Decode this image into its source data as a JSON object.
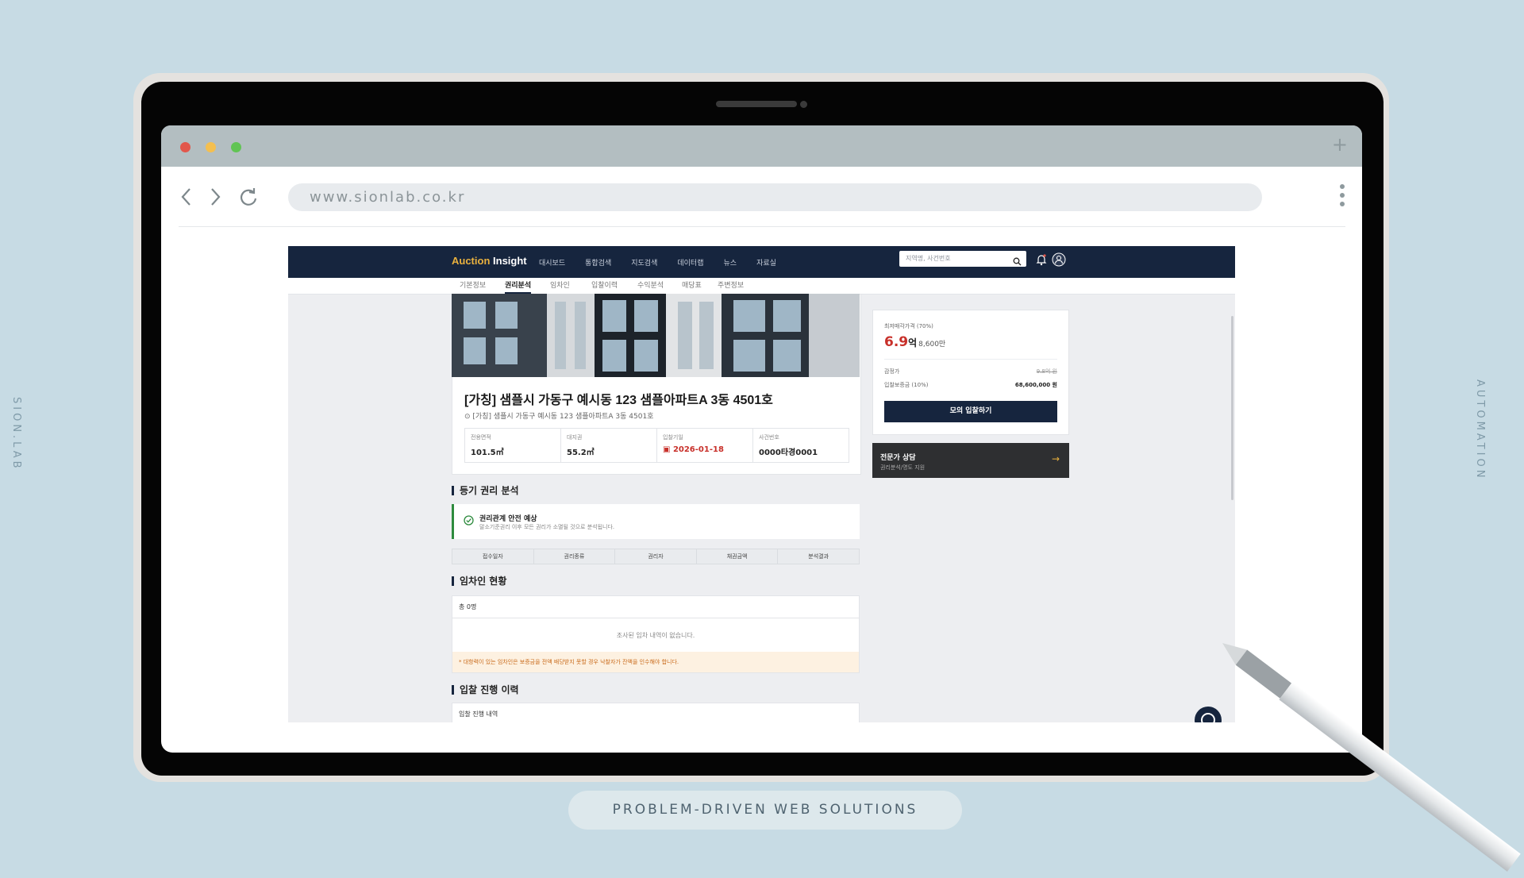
{
  "side": {
    "left": "SION.LAB",
    "right": "AUTOMATION"
  },
  "caption": "PROBLEM-DRIVEN WEB SOLUTIONS",
  "browser": {
    "url": "www.sionlab.co.kr",
    "new_tab_symbol": "+"
  },
  "site": {
    "logo_a": "Auction",
    "logo_b": "Insight",
    "menu": [
      "대시보드",
      "통합검색",
      "지도검색",
      "데이터랩",
      "뉴스",
      "자료실"
    ],
    "search_placeholder": "지역명, 사건번호"
  },
  "tabs": [
    "기본정보",
    "권리분석",
    "임차인",
    "입찰이력",
    "수익분석",
    "매당표",
    "주변정보"
  ],
  "active_tab": "권리분석",
  "property": {
    "title": "[가칭] 샘플시 가동구 예시동 123 샘플아파트A 3동 4501호",
    "address": "[가칭] 샘플시 가동구 예시동 123 샘플아파트A 3동 4501호",
    "info": [
      {
        "label": "전용면적",
        "value": "101.5㎡"
      },
      {
        "label": "대지권",
        "value": "55.2㎡"
      },
      {
        "label": "입찰기일",
        "value": "2026-01-18"
      },
      {
        "label": "사건번호",
        "value": "0000타경0001"
      }
    ]
  },
  "rights": {
    "section_title": "등기 권리 분석",
    "notice_title": "권리관계 안전 예상",
    "notice_sub": "말소기준권리 이후 모든 권리가 소멸될 것으로 분석됩니다.",
    "columns": [
      "접수일자",
      "권리종류",
      "권리자",
      "채권금액",
      "분석결과"
    ]
  },
  "tenants": {
    "section_title": "임차인 현황",
    "total": "총 0명",
    "empty": "조사된 임차 내역이 없습니다.",
    "warning": "* 대항력이 있는 임차인은 보증금을 전액 배당받지 못할 경우 낙찰자가 잔액을 인수해야 합니다."
  },
  "bids": {
    "section_title": "입찰 진행 이력",
    "box_title": "입찰 진행 내역"
  },
  "price": {
    "label": "최저매각가격 (70%)",
    "big": "6.9",
    "unit": "억",
    "small": "8,600만",
    "appraisal_label": "감정가",
    "appraisal_value": "9.8억 원",
    "deposit_label": "입찰보증금 (10%)",
    "deposit_value": "68,600,000 원",
    "button": "모의 입찰하기"
  },
  "expert": {
    "title": "전문가 상담",
    "sub": "권리분석/명도 지원",
    "arrow": "→"
  },
  "colors": {
    "navy": "#16253e",
    "accent_gold": "#e9b13e",
    "price_red": "#c8302a",
    "safe_green": "#2e8b3e"
  }
}
